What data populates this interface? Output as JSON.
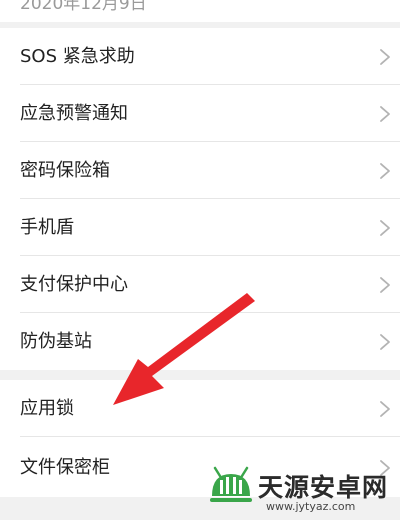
{
  "header": {
    "date_partial": "2020年12月9日"
  },
  "groups": [
    {
      "items": [
        {
          "label": "SOS 紧急求助",
          "icon": "chevron-right-icon"
        },
        {
          "label": "应急预警通知",
          "icon": "chevron-right-icon"
        },
        {
          "label": "密码保险箱",
          "icon": "chevron-right-icon"
        },
        {
          "label": "手机盾",
          "icon": "chevron-right-icon"
        },
        {
          "label": "支付保护中心",
          "icon": "chevron-right-icon"
        },
        {
          "label": "防伪基站",
          "icon": "chevron-right-icon"
        }
      ]
    },
    {
      "items": [
        {
          "label": "应用锁",
          "icon": "chevron-right-icon"
        },
        {
          "label": "文件保密柜",
          "icon": "chevron-right-icon"
        }
      ]
    }
  ],
  "annotation": {
    "icon": "red-arrow-pointer",
    "color": "#e8262b"
  },
  "watermark": {
    "title": "天源安卓网",
    "url": "www.jytyaz.com",
    "logo_color": "#3aa64a"
  },
  "colors": {
    "background": "#f1f1f1",
    "card": "#ffffff",
    "text": "#222222",
    "chevron": "#b3b3b3",
    "divider": "#e6e6e6"
  }
}
